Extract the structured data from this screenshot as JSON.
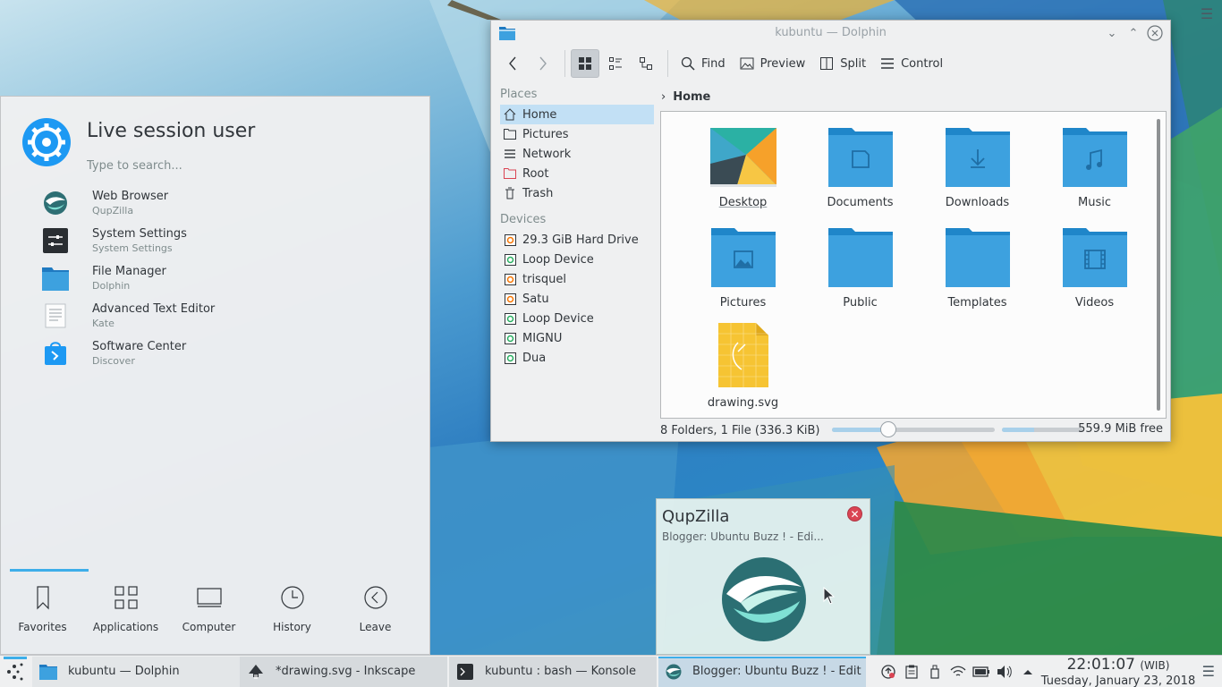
{
  "launcher": {
    "user_name": "Live session user",
    "search_placeholder": "Type to search...",
    "favorites": [
      {
        "title": "Web Browser",
        "subtitle": "QupZilla",
        "icon": "qupzilla-icon"
      },
      {
        "title": "System Settings",
        "subtitle": "System Settings",
        "icon": "settings-icon"
      },
      {
        "title": "File Manager",
        "subtitle": "Dolphin",
        "icon": "folder-icon"
      },
      {
        "title": "Advanced Text Editor",
        "subtitle": "Kate",
        "icon": "text-editor-icon"
      },
      {
        "title": "Software Center",
        "subtitle": "Discover",
        "icon": "discover-icon"
      }
    ],
    "tabs": [
      "Favorites",
      "Applications",
      "Computer",
      "History",
      "Leave"
    ]
  },
  "dolphin": {
    "title": "kubuntu — Dolphin",
    "toolbar": {
      "find": "Find",
      "preview": "Preview",
      "split": "Split",
      "control": "Control"
    },
    "places_heading": "Places",
    "places": [
      "Home",
      "Pictures",
      "Network",
      "Root",
      "Trash"
    ],
    "devices_heading": "Devices",
    "devices": [
      "29.3 GiB Hard Drive",
      "Loop Device",
      "trisquel",
      "Satu",
      "Loop Device",
      "MIGNU",
      "Dua"
    ],
    "breadcrumb": "Home",
    "files": [
      "Desktop",
      "Documents",
      "Downloads",
      "Music",
      "Pictures",
      "Public",
      "Templates",
      "Videos",
      "drawing.svg"
    ],
    "status_text": "8 Folders, 1 File (336.3 KiB)",
    "free_space": "559.9 MiB free",
    "zoom_fraction": 0.33,
    "space_used_fraction": 0.4
  },
  "tooltip": {
    "title": "QupZilla",
    "subtitle": "Blogger: Ubuntu Buzz ! - Edi..."
  },
  "taskbar": {
    "tasks": [
      "kubuntu — Dolphin",
      "*drawing.svg - Inkscape",
      "kubuntu : bash — Konsole",
      "Blogger: Ubuntu Buzz ! - Edit ..."
    ],
    "time": "22:01:07",
    "timezone": "(WIB)",
    "date": "Tuesday, January 23, 2018"
  },
  "colors": {
    "accent": "#3daee9",
    "folder": "#3da1df",
    "selection": "#c2e0f5",
    "close_red": "#da4453"
  }
}
